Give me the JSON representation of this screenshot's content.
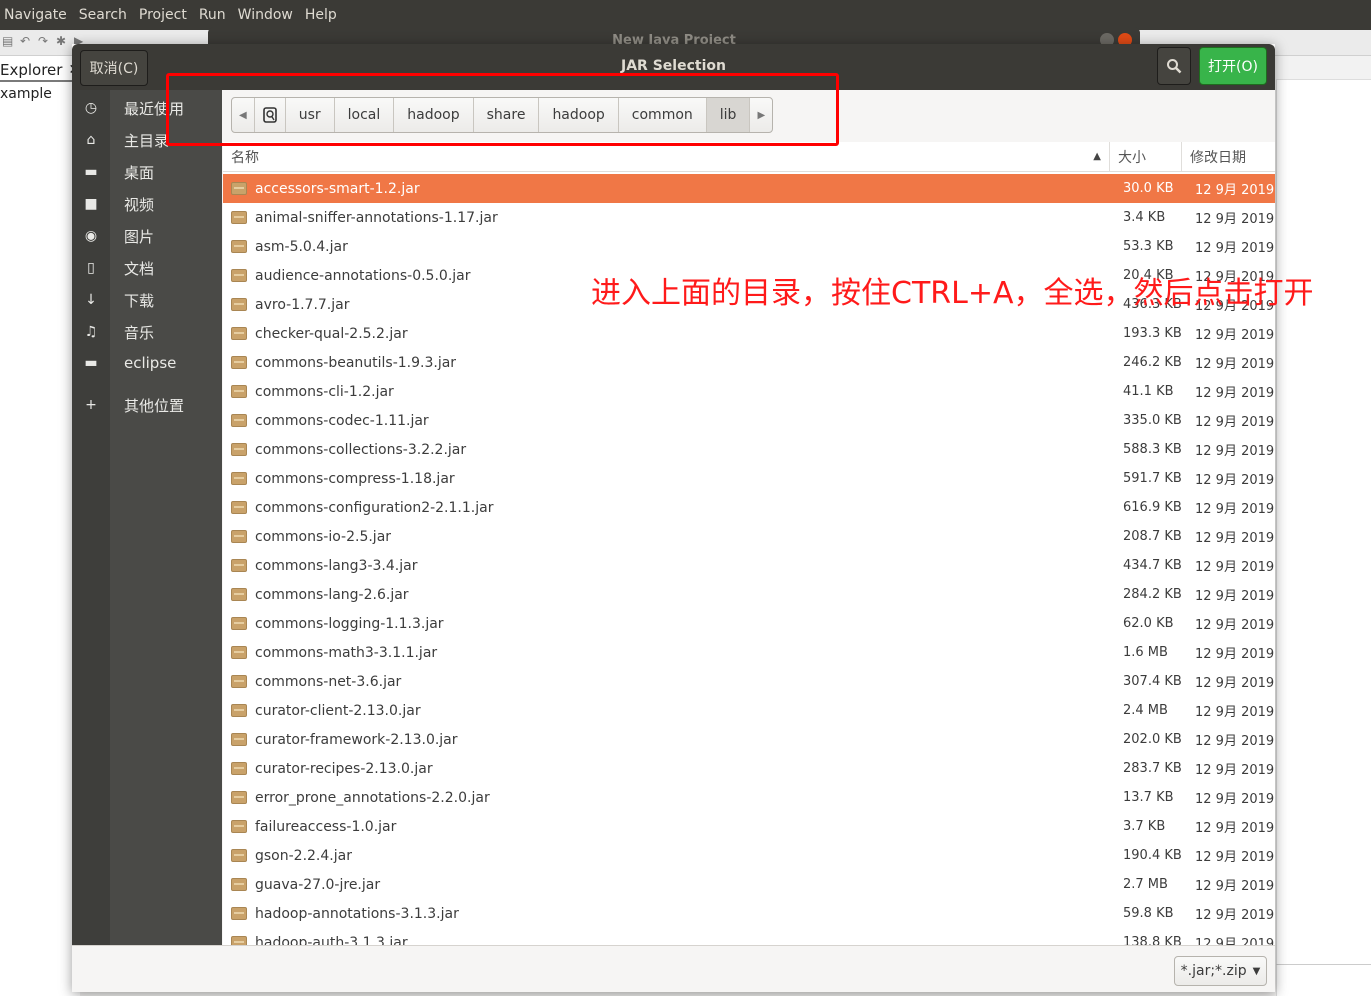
{
  "eclipse": {
    "menu": [
      "Navigate",
      "Search",
      "Project",
      "Run",
      "Window",
      "Help"
    ],
    "explorer_tab": "Explorer",
    "explorer_close": "✕",
    "project_item": "xample"
  },
  "behind_dialog": {
    "title": "New Java Project"
  },
  "dialog": {
    "title": "JAR Selection",
    "cancel_label": "取消(C)",
    "open_label": "打开(O)",
    "search_icon": "search-icon"
  },
  "sidebar": {
    "items": [
      {
        "label": "最近使用",
        "icon": "clock-icon",
        "glyph": "◷"
      },
      {
        "label": "主目录",
        "icon": "home-icon",
        "glyph": "⌂"
      },
      {
        "label": "桌面",
        "icon": "folder-icon",
        "glyph": "▬"
      },
      {
        "label": "视频",
        "icon": "video-icon",
        "glyph": "■"
      },
      {
        "label": "图片",
        "icon": "camera-icon",
        "glyph": "◉"
      },
      {
        "label": "文档",
        "icon": "document-icon",
        "glyph": "▯"
      },
      {
        "label": "下载",
        "icon": "download-icon",
        "glyph": "↓"
      },
      {
        "label": "音乐",
        "icon": "music-icon",
        "glyph": "♫"
      },
      {
        "label": "eclipse",
        "icon": "folder-icon",
        "glyph": "▬"
      },
      {
        "label": "其他位置",
        "icon": "plus-icon",
        "glyph": "+"
      }
    ]
  },
  "path": [
    "usr",
    "local",
    "hadoop",
    "share",
    "hadoop",
    "common",
    "lib"
  ],
  "columns": {
    "name": "名称",
    "size": "大小",
    "date": "修改日期",
    "sort_indicator": "▲"
  },
  "files": [
    {
      "name": "accessors-smart-1.2.jar",
      "size": "30.0 KB",
      "date": "12 9月 2019"
    },
    {
      "name": "animal-sniffer-annotations-1.17.jar",
      "size": "3.4 KB",
      "date": "12 9月 2019"
    },
    {
      "name": "asm-5.0.4.jar",
      "size": "53.3 KB",
      "date": "12 9月 2019"
    },
    {
      "name": "audience-annotations-0.5.0.jar",
      "size": "20.4 KB",
      "date": "12 9月 2019"
    },
    {
      "name": "avro-1.7.7.jar",
      "size": "436.3 KB",
      "date": "12 9月 2019"
    },
    {
      "name": "checker-qual-2.5.2.jar",
      "size": "193.3 KB",
      "date": "12 9月 2019"
    },
    {
      "name": "commons-beanutils-1.9.3.jar",
      "size": "246.2 KB",
      "date": "12 9月 2019"
    },
    {
      "name": "commons-cli-1.2.jar",
      "size": "41.1 KB",
      "date": "12 9月 2019"
    },
    {
      "name": "commons-codec-1.11.jar",
      "size": "335.0 KB",
      "date": "12 9月 2019"
    },
    {
      "name": "commons-collections-3.2.2.jar",
      "size": "588.3 KB",
      "date": "12 9月 2019"
    },
    {
      "name": "commons-compress-1.18.jar",
      "size": "591.7 KB",
      "date": "12 9月 2019"
    },
    {
      "name": "commons-configuration2-2.1.1.jar",
      "size": "616.9 KB",
      "date": "12 9月 2019"
    },
    {
      "name": "commons-io-2.5.jar",
      "size": "208.7 KB",
      "date": "12 9月 2019"
    },
    {
      "name": "commons-lang3-3.4.jar",
      "size": "434.7 KB",
      "date": "12 9月 2019"
    },
    {
      "name": "commons-lang-2.6.jar",
      "size": "284.2 KB",
      "date": "12 9月 2019"
    },
    {
      "name": "commons-logging-1.1.3.jar",
      "size": "62.0 KB",
      "date": "12 9月 2019"
    },
    {
      "name": "commons-math3-3.1.1.jar",
      "size": "1.6 MB",
      "date": "12 9月 2019"
    },
    {
      "name": "commons-net-3.6.jar",
      "size": "307.4 KB",
      "date": "12 9月 2019"
    },
    {
      "name": "curator-client-2.13.0.jar",
      "size": "2.4 MB",
      "date": "12 9月 2019"
    },
    {
      "name": "curator-framework-2.13.0.jar",
      "size": "202.0 KB",
      "date": "12 9月 2019"
    },
    {
      "name": "curator-recipes-2.13.0.jar",
      "size": "283.7 KB",
      "date": "12 9月 2019"
    },
    {
      "name": "error_prone_annotations-2.2.0.jar",
      "size": "13.7 KB",
      "date": "12 9月 2019"
    },
    {
      "name": "failureaccess-1.0.jar",
      "size": "3.7 KB",
      "date": "12 9月 2019"
    },
    {
      "name": "gson-2.2.4.jar",
      "size": "190.4 KB",
      "date": "12 9月 2019"
    },
    {
      "name": "guava-27.0-jre.jar",
      "size": "2.7 MB",
      "date": "12 9月 2019"
    },
    {
      "name": "hadoop-annotations-3.1.3.jar",
      "size": "59.8 KB",
      "date": "12 9月 2019"
    },
    {
      "name": "hadoop-auth-3.1.3.jar",
      "size": "138.8 KB",
      "date": "12 9月 2019"
    }
  ],
  "selected_index": 0,
  "filter": {
    "value": "*.jar;*.zip"
  },
  "annotation": {
    "text": "进入上面的目录，按住CTRL+A，全选，然后点击打开",
    "color": "#ff1a1a"
  }
}
